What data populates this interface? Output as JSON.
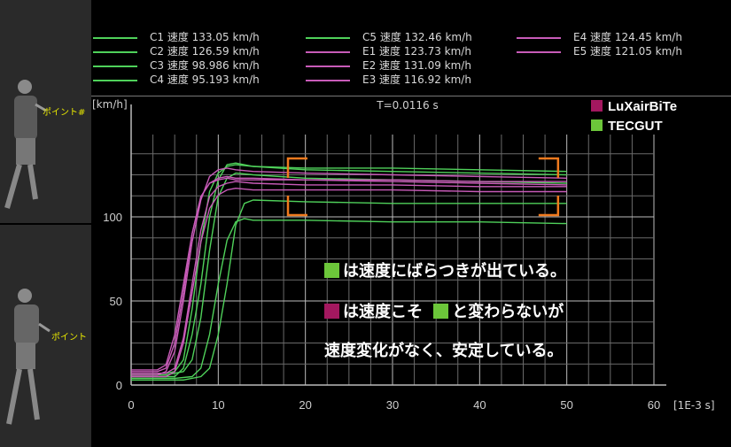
{
  "colors": {
    "green": "#4fd15a",
    "magenta": "#c85bb8",
    "lux_swatch": "#a3185f",
    "tec_swatch": "#6cc63a",
    "bracket": "#f07a1e"
  },
  "video": {
    "top_tag": "ポイント#",
    "bottom_tag": "ポイント"
  },
  "legend": [
    {
      "label": "C1 速度 133.05 km/h",
      "color": "green"
    },
    {
      "label": "C2 速度 126.59 km/h",
      "color": "green"
    },
    {
      "label": "C3 速度 98.986 km/h",
      "color": "green"
    },
    {
      "label": "C4 速度 95.193 km/h",
      "color": "green"
    },
    {
      "label": "C5 速度 132.46 km/h",
      "color": "green"
    },
    {
      "label": "E1 速度 123.73 km/h",
      "color": "magenta"
    },
    {
      "label": "E2 速度 131.09 km/h",
      "color": "magenta"
    },
    {
      "label": "E3 速度 116.92 km/h",
      "color": "magenta"
    },
    {
      "label": "E4 速度 124.45 km/h",
      "color": "magenta"
    },
    {
      "label": "E5 速度 121.05 km/h",
      "color": "magenta"
    }
  ],
  "brands": [
    {
      "label": "LuXairBiTe",
      "color": "lux_swatch"
    },
    {
      "label": "TECGUT",
      "color": "tec_swatch"
    }
  ],
  "notes": {
    "line1": "は速度にばらつきが出ている。",
    "line2a": "は速度こそ",
    "line2b": "と変わらないが",
    "line3": "速度変化がなく、安定している。"
  },
  "chart_data": {
    "type": "line",
    "title": "T=0.0116 s",
    "ylabel": "[km/h]",
    "xlabel": "[1E-3 s]",
    "xlim": [
      0,
      60
    ],
    "ylim": [
      0,
      140
    ],
    "xticks": [
      0,
      10,
      20,
      30,
      40,
      50,
      60
    ],
    "yticks": [
      0,
      50,
      100
    ],
    "grid": true,
    "series": [
      {
        "name": "C1",
        "color": "green",
        "x": [
          0,
          3,
          5,
          6,
          7,
          8,
          9,
          10,
          11,
          12,
          14,
          20,
          30,
          40,
          50
        ],
        "y": [
          5,
          5,
          5,
          10,
          30,
          60,
          100,
          122,
          131,
          132,
          130,
          129,
          129,
          128,
          127
        ]
      },
      {
        "name": "C2",
        "color": "green",
        "x": [
          0,
          4,
          6,
          7,
          8,
          9,
          10,
          11,
          12,
          14,
          20,
          30,
          40,
          50
        ],
        "y": [
          6,
          6,
          8,
          15,
          40,
          80,
          112,
          123,
          126,
          125,
          123,
          122,
          121,
          120
        ]
      },
      {
        "name": "C3",
        "color": "green",
        "x": [
          0,
          5,
          7,
          8,
          9,
          10,
          11,
          12,
          13,
          14,
          20,
          30,
          40,
          50
        ],
        "y": [
          4,
          4,
          5,
          10,
          30,
          60,
          86,
          97,
          99,
          98,
          98,
          97,
          97,
          96
        ]
      },
      {
        "name": "C4",
        "color": "green",
        "x": [
          0,
          6,
          8,
          9,
          10,
          11,
          12,
          13,
          14,
          20,
          30,
          40,
          50
        ],
        "y": [
          3,
          3,
          5,
          10,
          30,
          60,
          95,
          108,
          110,
          109,
          108,
          108,
          108
        ]
      },
      {
        "name": "C5",
        "color": "green",
        "x": [
          0,
          4,
          5,
          6,
          7,
          8,
          9,
          10,
          11,
          12,
          14,
          20,
          30,
          40,
          50
        ],
        "y": [
          7,
          7,
          8,
          15,
          45,
          85,
          115,
          126,
          130,
          131,
          130,
          128,
          127,
          126,
          125
        ]
      },
      {
        "name": "E1",
        "color": "magenta",
        "x": [
          0,
          3,
          4,
          5,
          6,
          7,
          8,
          9,
          10,
          11,
          12,
          14,
          20,
          30,
          40,
          50
        ],
        "y": [
          8,
          8,
          10,
          25,
          55,
          90,
          112,
          120,
          122,
          123,
          122,
          122,
          122,
          121,
          120,
          119
        ]
      },
      {
        "name": "E2",
        "color": "magenta",
        "x": [
          0,
          3,
          4,
          5,
          6,
          7,
          8,
          9,
          10,
          11,
          12,
          14,
          20,
          30,
          40,
          50
        ],
        "y": [
          6,
          6,
          8,
          20,
          50,
          85,
          110,
          124,
          128,
          129,
          128,
          127,
          126,
          125,
          124,
          123
        ]
      },
      {
        "name": "E3",
        "color": "magenta",
        "x": [
          0,
          4,
          5,
          6,
          7,
          8,
          9,
          10,
          11,
          12,
          14,
          20,
          30,
          40,
          50
        ],
        "y": [
          5,
          5,
          8,
          25,
          55,
          85,
          105,
          113,
          116,
          117,
          116,
          116,
          116,
          115,
          115
        ]
      },
      {
        "name": "E4",
        "color": "magenta",
        "x": [
          0,
          3,
          4,
          5,
          6,
          7,
          8,
          9,
          10,
          11,
          12,
          14,
          20,
          30,
          40,
          50
        ],
        "y": [
          9,
          9,
          12,
          30,
          60,
          90,
          112,
          120,
          123,
          124,
          123,
          123,
          122,
          122,
          121,
          121
        ]
      },
      {
        "name": "E5",
        "color": "magenta",
        "x": [
          0,
          4,
          5,
          6,
          7,
          8,
          9,
          10,
          11,
          12,
          14,
          20,
          30,
          40,
          50
        ],
        "y": [
          7,
          7,
          10,
          28,
          60,
          92,
          112,
          118,
          120,
          121,
          120,
          119,
          119,
          118,
          118
        ]
      }
    ]
  }
}
